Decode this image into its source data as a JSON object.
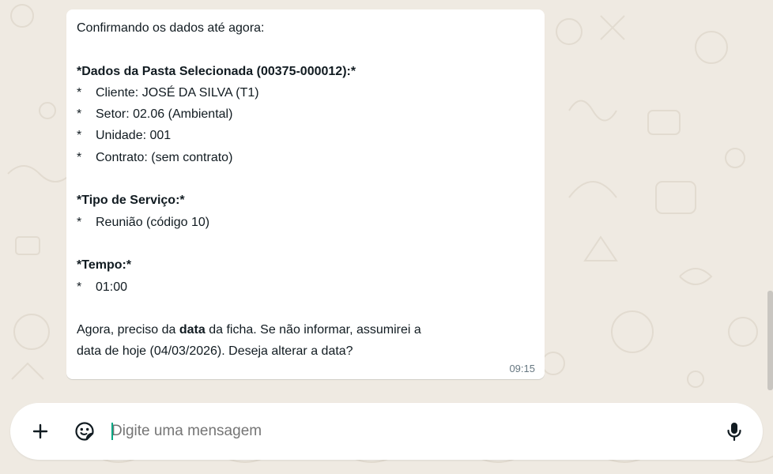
{
  "message": {
    "intro": "Confirmando os dados até agora:",
    "folder_heading": "*Dados da Pasta Selecionada (00375-000012):*",
    "folder_items": [
      "Cliente: JOSÉ DA SILVA (T1)",
      "Setor: 02.06 (Ambiental)",
      "Unidade: 001",
      "Contrato: (sem contrato)"
    ],
    "service_heading": "*Tipo de Serviço:*",
    "service_items": [
      "Reunião (código 10)"
    ],
    "time_heading": "*Tempo:*",
    "time_items": [
      "01:00"
    ],
    "bullet_symbol": "*",
    "closing_part1": "Agora, preciso da ",
    "closing_bold": "data",
    "closing_part2": " da ficha. Se não informar, assumirei a",
    "closing_line2": "data de hoje (04/03/2026). Deseja alterar a data?",
    "timestamp": "09:15"
  },
  "composer": {
    "placeholder": "Digite uma mensagem",
    "attach_icon": "plus-icon",
    "sticker_icon": "sticker-icon",
    "mic_icon": "microphone-icon"
  },
  "colors": {
    "background": "#efeae2",
    "bubble": "#ffffff",
    "text": "#111b21",
    "meta": "#667781",
    "accent": "#00a884"
  }
}
